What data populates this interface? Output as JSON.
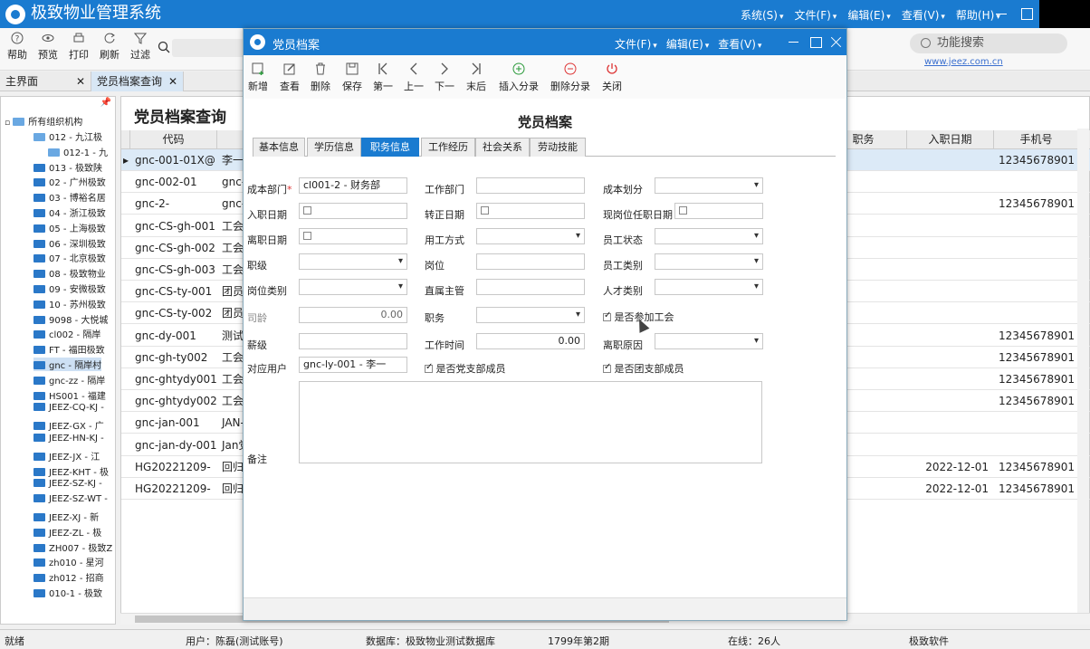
{
  "app": {
    "title": "极致物业管理系统",
    "menu": [
      "系统(S)",
      "文件(F)",
      "编辑(E)",
      "查看(V)",
      "帮助(H)"
    ]
  },
  "toolbar": {
    "buttons": [
      {
        "label": "帮助",
        "icon": "help-icon"
      },
      {
        "label": "预览",
        "icon": "eye-icon"
      },
      {
        "label": "打印",
        "icon": "printer-icon"
      },
      {
        "label": "刷新",
        "icon": "refresh-icon"
      },
      {
        "label": "过滤",
        "icon": "filter-icon"
      }
    ],
    "function_search": "功能搜索",
    "site_link": "www.jeez.com.cn"
  },
  "tabs": [
    {
      "label": "主界面",
      "active": false
    },
    {
      "label": "党员档案查询",
      "active": true
    }
  ],
  "tree": {
    "root": "所有组织机构",
    "items": [
      {
        "label": "012 - 九江极",
        "level": 1,
        "open": true
      },
      {
        "label": "012-1 - 九",
        "level": 2,
        "open": true
      },
      {
        "label": "013 - 极致陕",
        "level": 1
      },
      {
        "label": "02 - 广州极致",
        "level": 1
      },
      {
        "label": "03 - 博裕名居",
        "level": 1
      },
      {
        "label": "04 - 浙江极致",
        "level": 1
      },
      {
        "label": "05 - 上海极致",
        "level": 1
      },
      {
        "label": "06 - 深圳极致",
        "level": 1
      },
      {
        "label": "07 - 北京极致",
        "level": 1
      },
      {
        "label": "08 - 极致物业",
        "level": 1
      },
      {
        "label": "09 - 安微极致",
        "level": 1
      },
      {
        "label": "10 - 苏州极致",
        "level": 1
      },
      {
        "label": "9098 - 大悦城",
        "level": 1
      },
      {
        "label": "cl002 - 隔岸",
        "level": 1
      },
      {
        "label": "FT - 福田极致",
        "level": 1
      },
      {
        "label": "gnc - 隔岸村",
        "level": 1,
        "selected": true
      },
      {
        "label": "gnc-zz - 隔岸",
        "level": 1
      },
      {
        "label": "HS001 - 福建",
        "level": 1
      },
      {
        "label": "JEEZ-CQ-KJ -",
        "level": 1
      },
      {
        "label": "JEEZ-GX - 广",
        "level": 1
      },
      {
        "label": "JEEZ-HN-KJ -",
        "level": 1
      },
      {
        "label": "JEEZ-JX - 江",
        "level": 1
      },
      {
        "label": "JEEZ-KHT - 极",
        "level": 1
      },
      {
        "label": "JEEZ-SZ-KJ -",
        "level": 1
      },
      {
        "label": "JEEZ-SZ-WT -",
        "level": 1
      },
      {
        "label": "JEEZ-XJ - 新",
        "level": 1
      },
      {
        "label": "JEEZ-ZL - 极",
        "level": 1
      },
      {
        "label": "ZH007 - 极致Z",
        "level": 1
      },
      {
        "label": "zh010 - 星河",
        "level": 1
      },
      {
        "label": "zh012 - 招商",
        "level": 1
      },
      {
        "label": "010-1 - 极致",
        "level": 1
      }
    ]
  },
  "grid": {
    "title": "党员档案查询",
    "columns": [
      "代码",
      "职务",
      "入职日期",
      "手机号"
    ],
    "rows": [
      {
        "code": "gnc-001-01X@",
        "name": "李一",
        "date": "",
        "phone": "12345678901",
        "selected": true
      },
      {
        "code": "gnc-002-01",
        "name": "gnc-",
        "date": "",
        "phone": ""
      },
      {
        "code": "gnc-2-",
        "name": "gnc-",
        "date": "",
        "phone": "12345678901"
      },
      {
        "code": "gnc-CS-gh-001",
        "name": "工会",
        "date": "",
        "phone": ""
      },
      {
        "code": "gnc-CS-gh-002",
        "name": "工会",
        "date": "",
        "phone": ""
      },
      {
        "code": "gnc-CS-gh-003",
        "name": "工会",
        "date": "",
        "phone": ""
      },
      {
        "code": "gnc-CS-ty-001",
        "name": "团员",
        "date": "",
        "phone": ""
      },
      {
        "code": "gnc-CS-ty-002",
        "name": "团员",
        "date": "",
        "phone": ""
      },
      {
        "code": "gnc-dy-001",
        "name": "测试",
        "date": "",
        "phone": "12345678901"
      },
      {
        "code": "gnc-gh-ty002",
        "name": "工会",
        "date": "",
        "phone": "12345678901"
      },
      {
        "code": "gnc-ghtydy001",
        "name": "工会",
        "date": "",
        "phone": "12345678901"
      },
      {
        "code": "gnc-ghtydy002",
        "name": "工会",
        "date": "",
        "phone": "12345678901"
      },
      {
        "code": "gnc-jan-001",
        "name": "JAN-",
        "date": "",
        "phone": ""
      },
      {
        "code": "gnc-jan-dy-001",
        "name": "Jan党",
        "date": "",
        "phone": ""
      },
      {
        "code": "HG20221209-",
        "name": "回归",
        "date": "2022-12-01",
        "phone": "12345678901"
      },
      {
        "code": "HG20221209-",
        "name": "回归",
        "date": "2022-12-01",
        "phone": "12345678901"
      }
    ]
  },
  "status": {
    "ready": "就绪",
    "user": "用户：陈磊(测试账号)",
    "database": "数据库：极致物业测试数据库",
    "period": "1799年第2期",
    "online": "在线：26人",
    "vendor": "极致软件"
  },
  "dialog": {
    "title": "党员档案",
    "menu": [
      "文件(F)",
      "编辑(E)",
      "查看(V)"
    ],
    "toolbar": [
      {
        "label": "新增",
        "icon": "add-icon"
      },
      {
        "label": "查看",
        "icon": "edit-icon"
      },
      {
        "label": "删除",
        "icon": "trash-icon"
      },
      {
        "label": "保存",
        "icon": "save-icon"
      },
      {
        "label": "第一",
        "icon": "first-icon"
      },
      {
        "label": "上一",
        "icon": "prev-icon"
      },
      {
        "label": "下一",
        "icon": "next-icon"
      },
      {
        "label": "末后",
        "icon": "last-icon"
      },
      {
        "label": "插入分录",
        "icon": "plus-circle-icon"
      },
      {
        "label": "删除分录",
        "icon": "minus-circle-icon"
      },
      {
        "label": "关闭",
        "icon": "power-icon"
      }
    ],
    "heading": "党员档案",
    "tabs": [
      "基本信息",
      "学历信息",
      "职务信息",
      "工作经历",
      "社会关系",
      "劳动技能"
    ],
    "active_tab": 2,
    "fields": {
      "cost_dept": {
        "label": "成本部门",
        "value": "cl001-2 - 财务部",
        "required": "*"
      },
      "work_dept": {
        "label": "工作部门",
        "value": ""
      },
      "cost_div": {
        "label": "成本划分",
        "value": ""
      },
      "hire_date": {
        "label": "入职日期",
        "value": ""
      },
      "regular_date": {
        "label": "转正日期",
        "value": ""
      },
      "post_date": {
        "label": "现岗位任职日期",
        "value": ""
      },
      "leave_date": {
        "label": "离职日期",
        "value": ""
      },
      "employ_mode": {
        "label": "用工方式",
        "value": ""
      },
      "emp_status": {
        "label": "员工状态",
        "value": ""
      },
      "grade": {
        "label": "职级",
        "value": ""
      },
      "post": {
        "label": "岗位",
        "value": ""
      },
      "emp_type": {
        "label": "员工类别",
        "value": ""
      },
      "post_type": {
        "label": "岗位类别",
        "value": ""
      },
      "supervisor": {
        "label": "直属主管",
        "value": ""
      },
      "talent_type": {
        "label": "人才类别",
        "value": ""
      },
      "seniority": {
        "label": "司龄",
        "value": "0.00"
      },
      "duty": {
        "label": "职务",
        "value": ""
      },
      "union": {
        "label": "是否参加工会",
        "checked": true
      },
      "salary_grade": {
        "label": "薪级",
        "value": ""
      },
      "work_time": {
        "label": "工作时间",
        "value": "0.00"
      },
      "leave_reason": {
        "label": "离职原因",
        "value": ""
      },
      "user": {
        "label": "对应用户",
        "value": "gnc-ly-001 - 李一"
      },
      "party_branch": {
        "label": "是否党支部成员",
        "checked": true
      },
      "league_branch": {
        "label": "是否团支部成员",
        "checked": true
      },
      "remark": {
        "label": "备注",
        "value": ""
      }
    }
  },
  "colors": {
    "accent": "#1a7bd0",
    "selected_row": "#dceaf7"
  }
}
